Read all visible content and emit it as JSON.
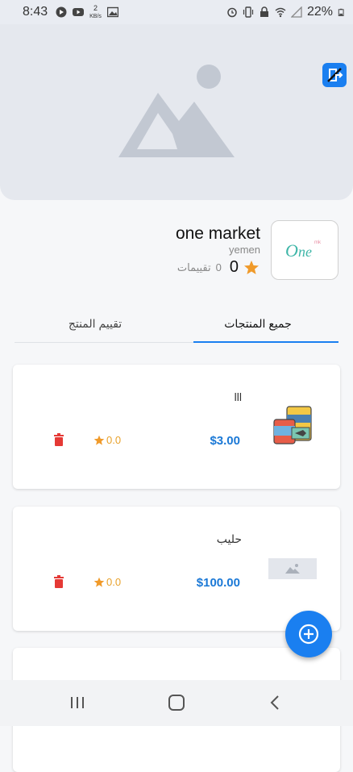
{
  "status_bar": {
    "time": "8:43",
    "net_speed": "2",
    "net_unit": "KB/s",
    "battery": "22%"
  },
  "banner": {
    "image": "image-placeholder-icon",
    "exit_icon": "exit-icon"
  },
  "store": {
    "name": "one market",
    "location": "yemen",
    "rating_value": "0",
    "rating_count": "0",
    "rating_label": "تقييمات",
    "logo_text": "One"
  },
  "tabs": [
    {
      "label": "جميع المنتجات",
      "active": true
    },
    {
      "label": "تقييم المنتج",
      "active": false
    }
  ],
  "products": [
    {
      "name": "lll",
      "price": "$3.00",
      "rating": "0.0"
    },
    {
      "name": "حليب",
      "price": "$100.00",
      "rating": "0.0"
    },
    {
      "name": "",
      "price": "",
      "rating": ""
    }
  ],
  "colors": {
    "accent": "#1a7ff0",
    "price": "#1a78d6",
    "star": "#e8a12a",
    "delete": "#e53935"
  }
}
